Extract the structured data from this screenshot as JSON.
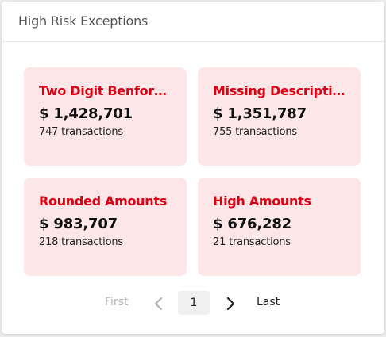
{
  "panel": {
    "title": "High Risk Exceptions"
  },
  "cards": [
    {
      "title": "Two Digit Benford's Law",
      "amount": "$ 1,428,701",
      "count": "747 transactions"
    },
    {
      "title": "Missing Descriptions",
      "amount": "$ 1,351,787",
      "count": "755 transactions"
    },
    {
      "title": "Rounded Amounts",
      "amount": "$ 983,707",
      "count": "218 transactions"
    },
    {
      "title": "High Amounts",
      "amount": "$ 676,282",
      "count": "21 transactions"
    }
  ],
  "pager": {
    "first": "First",
    "current_page": "1",
    "last": "Last",
    "prev_icon": "chevron-left-icon",
    "next_icon": "chevron-right-icon"
  },
  "colors": {
    "card_background": "#fde6e8",
    "card_title": "#dd0014",
    "disabled_text": "#b5b5b5"
  }
}
